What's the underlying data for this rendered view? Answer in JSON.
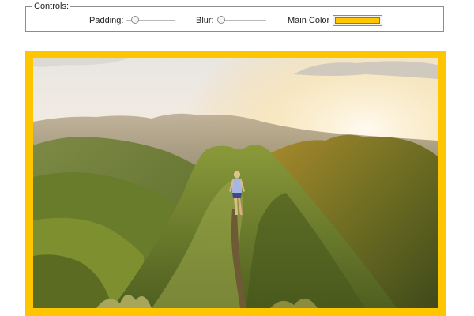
{
  "controls": {
    "legend": "Controls:",
    "padding": {
      "label": "Padding:",
      "value": 0.1
    },
    "blur": {
      "label": "Blur:",
      "value": 0
    },
    "main_color": {
      "label": "Main Color",
      "value": "#ffc600"
    }
  },
  "image": {
    "subject": "hiker on mountain ridge at sunset",
    "frame_color": "#ffc600"
  }
}
